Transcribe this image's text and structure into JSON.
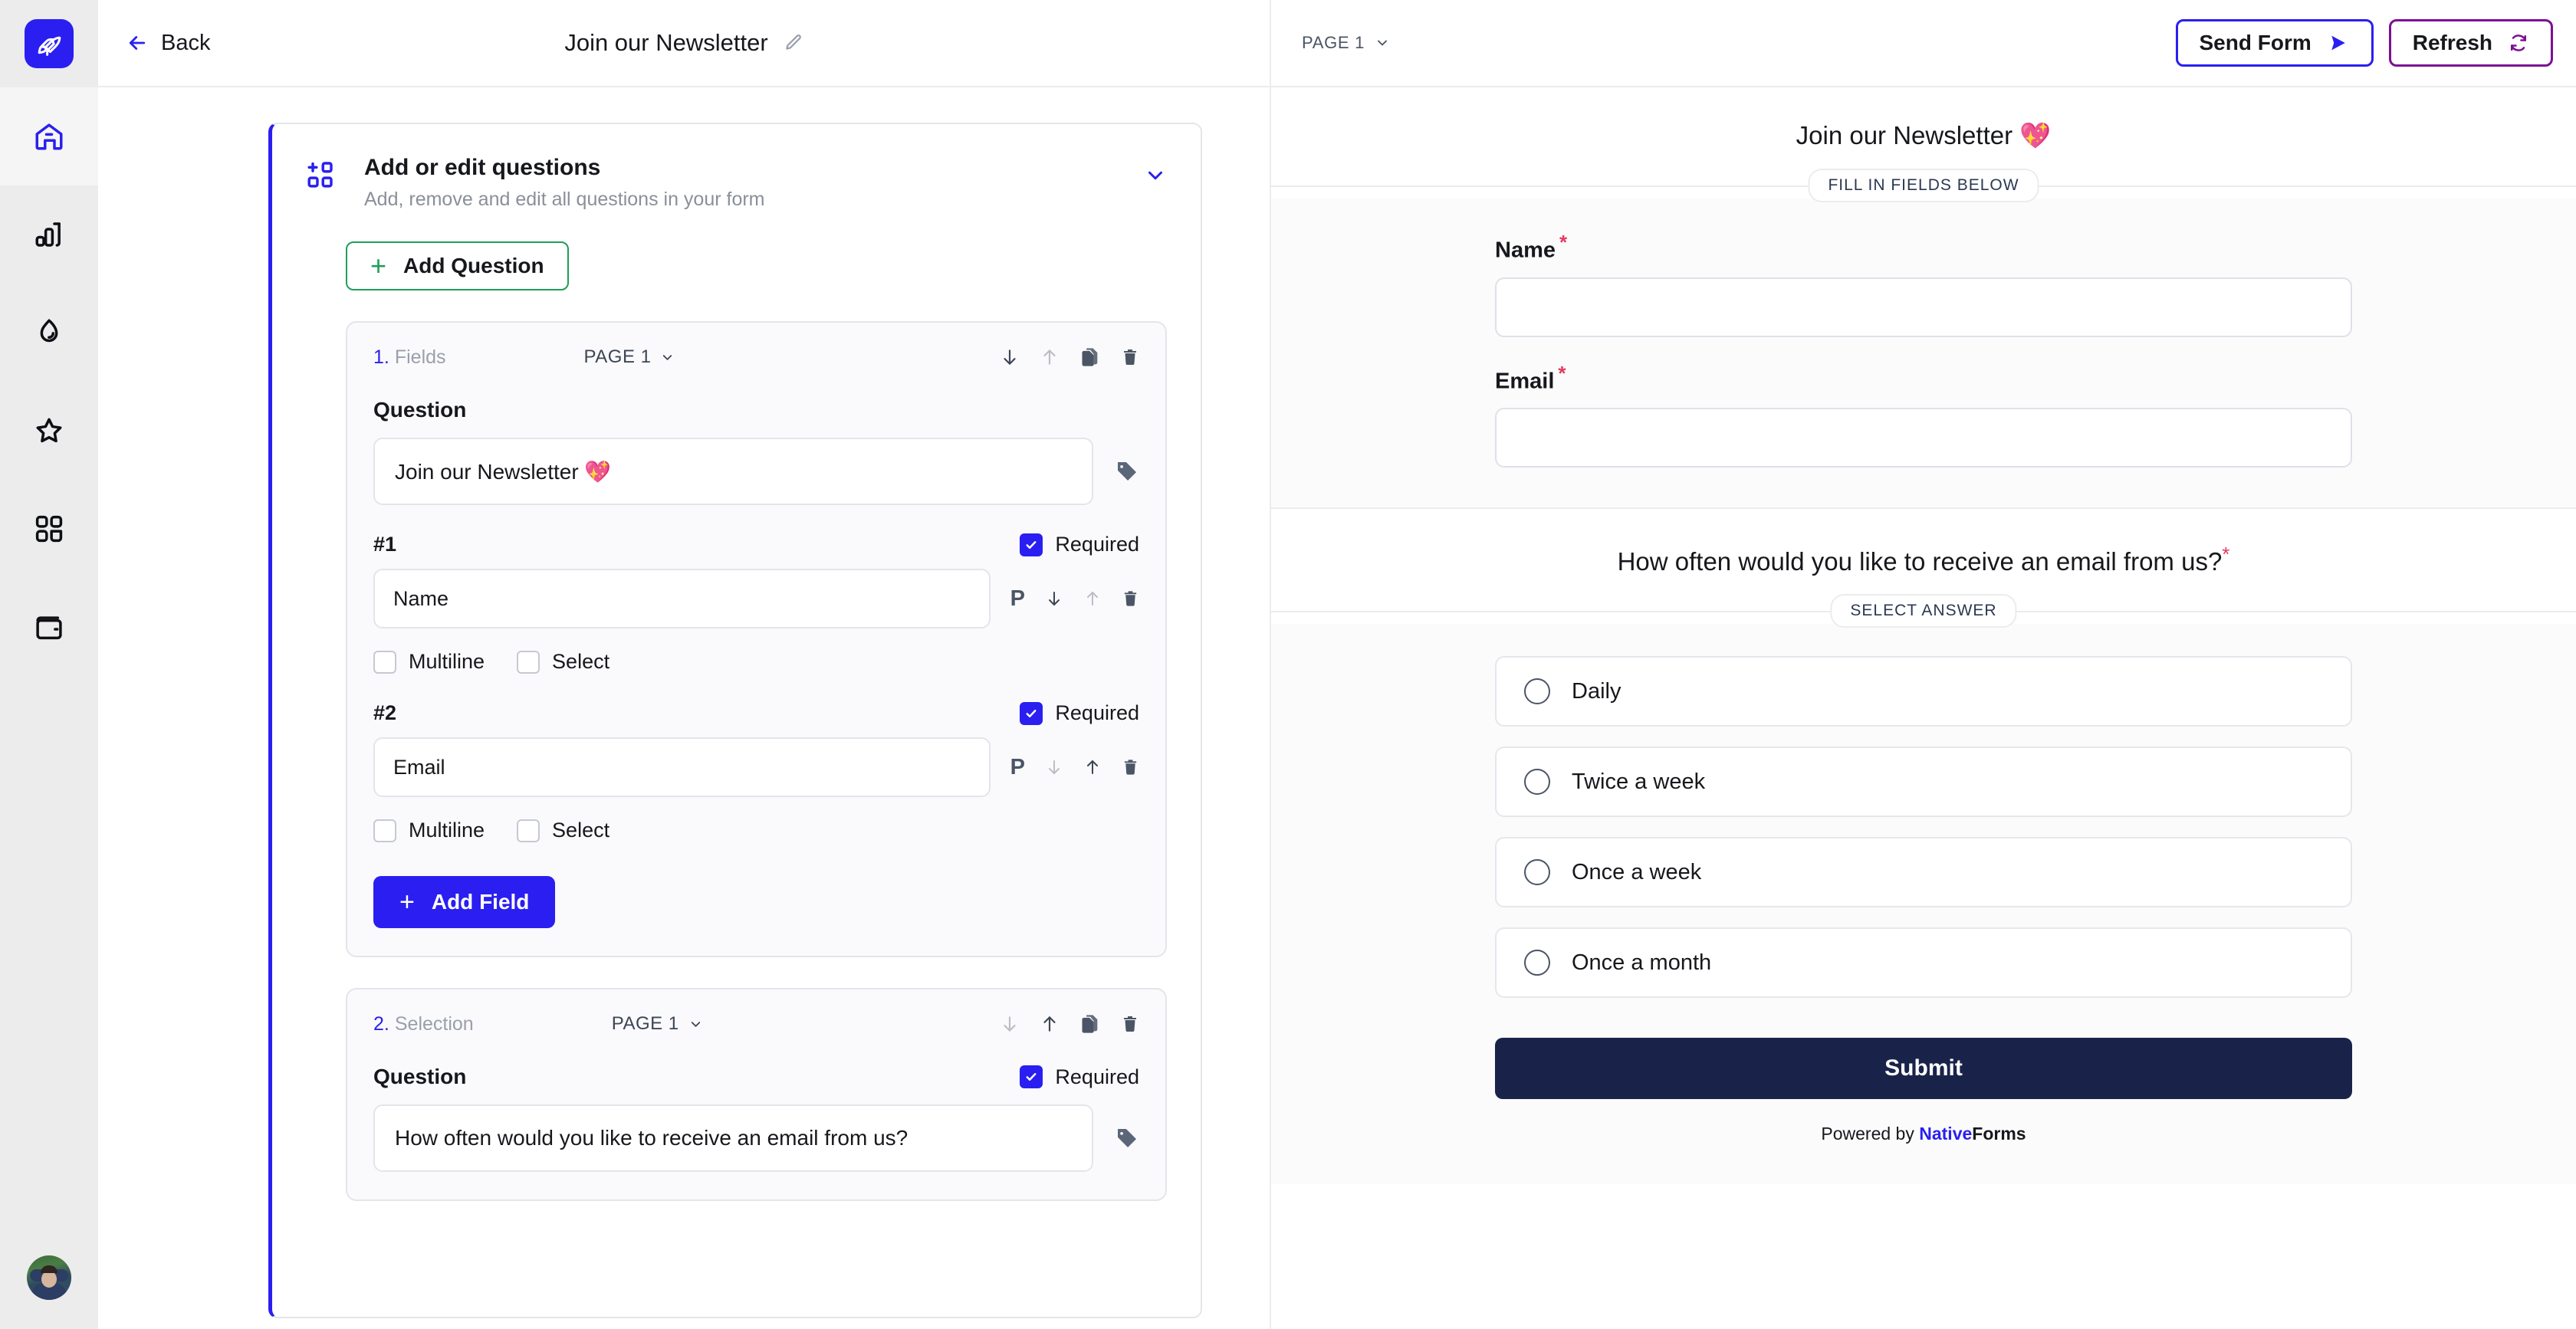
{
  "sidebar": {
    "logo_icon": "rocket-icon",
    "items": [
      {
        "icon": "home-icon",
        "name": "home",
        "active": true
      },
      {
        "icon": "bar-chart-icon",
        "name": "analytics",
        "active": false
      },
      {
        "icon": "flame-icon",
        "name": "trending",
        "active": false
      },
      {
        "icon": "star-icon",
        "name": "favorites",
        "active": false
      },
      {
        "icon": "grid-icon",
        "name": "apps",
        "active": false
      },
      {
        "icon": "wallet-icon",
        "name": "billing",
        "active": false
      }
    ],
    "avatar_label": "user-avatar"
  },
  "topbar": {
    "back_label": "Back",
    "back_icon": "arrow-left-icon",
    "form_title": "Join our Newsletter",
    "edit_icon": "pencil-icon",
    "page_select": "PAGE 1",
    "page_chevron_icon": "chevron-down-icon",
    "send_form_label": "Send Form",
    "send_form_icon": "send-arrow-icon",
    "refresh_label": "Refresh",
    "refresh_icon": "refresh-icon"
  },
  "editor": {
    "section_icon": "add-blocks-icon",
    "section_title": "Add or edit questions",
    "section_subtitle": "Add, remove and edit all questions in your form",
    "collapse_icon": "chevron-down-icon",
    "add_question_label": "Add Question",
    "add_field_label": "Add Field",
    "question_label": "Question",
    "required_label": "Required",
    "multiline_label": "Multiline",
    "select_label": "Select",
    "placeholder_icon_label": "P",
    "cards": [
      {
        "number": "1.",
        "kind": "Fields",
        "page": "PAGE 1",
        "question_value": "Join our Newsletter 💖",
        "tools": {
          "move_down": "enabled",
          "move_up": "disabled"
        },
        "fields": [
          {
            "index": "#1",
            "value": "Name",
            "required": true,
            "multiline": false,
            "select": false,
            "move_down": "enabled",
            "move_up": "disabled"
          },
          {
            "index": "#2",
            "value": "Email",
            "required": true,
            "multiline": false,
            "select": false,
            "move_down": "disabled",
            "move_up": "enabled"
          }
        ]
      },
      {
        "number": "2.",
        "kind": "Selection",
        "page": "PAGE 1",
        "required": true,
        "question_value": "How often would you like to receive an email from us?",
        "tools": {
          "move_down": "disabled",
          "move_up": "enabled"
        }
      }
    ]
  },
  "preview": {
    "sections": [
      {
        "title": "Join our Newsletter 💖",
        "required_star": "",
        "chip": "FILL IN FIELDS BELOW",
        "type": "fields",
        "fields": [
          {
            "label": "Name",
            "required_star": "*",
            "value": ""
          },
          {
            "label": "Email",
            "required_star": "*",
            "value": ""
          }
        ]
      },
      {
        "title": "How often would you like to receive an email from us?",
        "required_star": "*",
        "chip": "SELECT ANSWER",
        "type": "options",
        "options": [
          {
            "label": "Daily",
            "selected": false
          },
          {
            "label": "Twice a week",
            "selected": false
          },
          {
            "label": "Once a week",
            "selected": false
          },
          {
            "label": "Once a month",
            "selected": false
          }
        ],
        "submit_label": "Submit",
        "powered_prefix": "Powered by ",
        "powered_brand_a": "Native",
        "powered_brand_b": "Forms"
      }
    ]
  },
  "colors": {
    "brand_blue": "#2a1ff0",
    "green": "#1f9e5a",
    "purple": "#7d0f94",
    "required_red": "#e5395f",
    "submit_navy": "#19234a"
  }
}
